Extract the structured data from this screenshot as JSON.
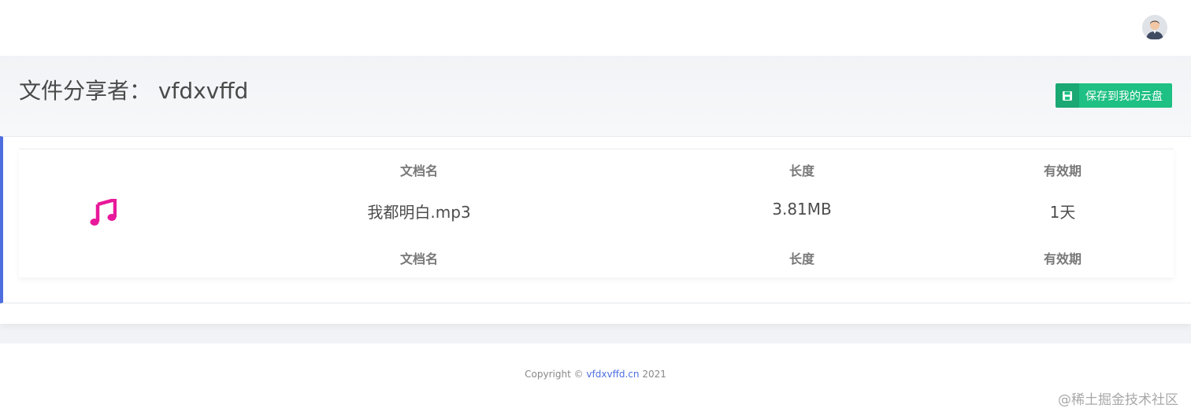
{
  "header": {
    "avatar_icon": "user-avatar"
  },
  "page": {
    "title": "文件分享者： vfdxvffd",
    "save_button_label": "保存到我的云盘",
    "save_icon": "floppy-disk-icon"
  },
  "file_table": {
    "columns": [
      "文档名",
      "长度",
      "有效期"
    ],
    "footer_columns": [
      "文档名",
      "长度",
      "有效期"
    ],
    "row": {
      "icon": "music-note-icon",
      "name": "我都明白.mp3",
      "size": "3.81MB",
      "validity": "1天"
    }
  },
  "footer": {
    "copyright_prefix": "Copyright ©",
    "site_link": "vfdxvffd.cn",
    "year": "2021"
  },
  "watermark": "@稀土掘金技术社区",
  "colors": {
    "accent": "#4e6edf",
    "save_button": "#1ec083",
    "music_icon": "#e8199a"
  }
}
